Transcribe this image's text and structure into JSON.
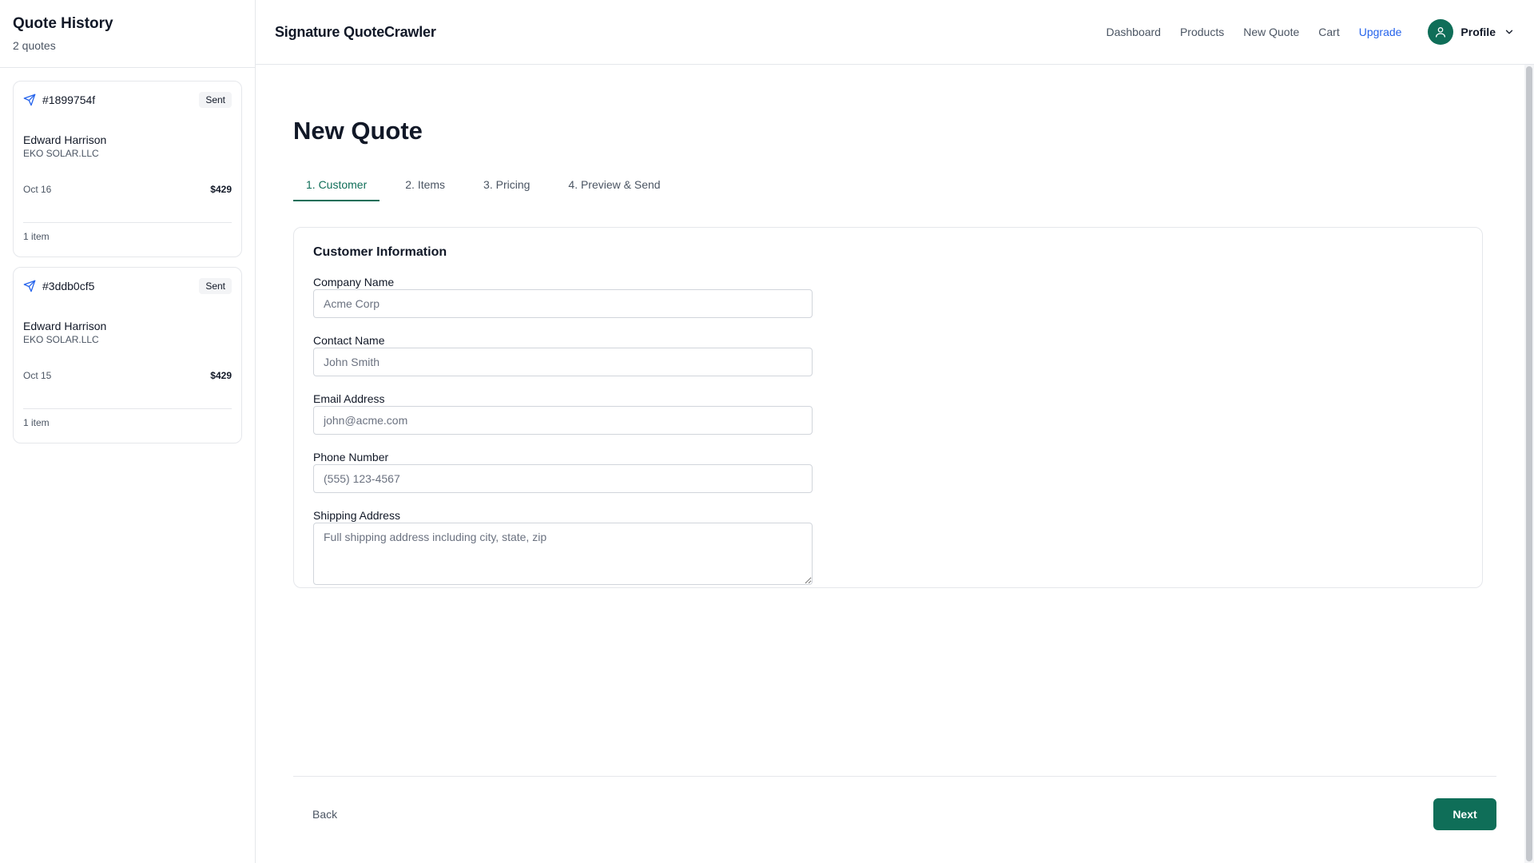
{
  "sidebar": {
    "title": "Quote History",
    "count": "2 quotes",
    "quotes": [
      {
        "id": "#1899754f",
        "status": "Sent",
        "customer": "Edward Harrison",
        "company": "EKO SOLAR.LLC",
        "date": "Oct 16",
        "total": "$429",
        "items": "1 item"
      },
      {
        "id": "#3ddb0cf5",
        "status": "Sent",
        "customer": "Edward Harrison",
        "company": "EKO SOLAR.LLC",
        "date": "Oct 15",
        "total": "$429",
        "items": "1 item"
      }
    ]
  },
  "topbar": {
    "brand": "Signature QuoteCrawler",
    "nav": [
      "Dashboard",
      "Products",
      "New Quote",
      "Cart",
      "Upgrade"
    ],
    "profile_label": "Profile"
  },
  "page": {
    "title": "New Quote",
    "tabs": [
      "1. Customer",
      "2. Items",
      "3. Pricing",
      "4. Preview & Send"
    ],
    "active_tab": "1. Customer"
  },
  "form": {
    "section_title": "Customer Information",
    "fields": [
      {
        "label": "Company Name",
        "value": "",
        "placeholder": "Acme Corp"
      },
      {
        "label": "Contact Name",
        "value": "",
        "placeholder": "John Smith"
      },
      {
        "label": "Email Address",
        "value": "",
        "placeholder": "john@acme.com"
      },
      {
        "label": "Phone Number",
        "value": "",
        "placeholder": "(555) 123-4567"
      },
      {
        "label": "Shipping Address",
        "value": "",
        "placeholder": "Full shipping address including city, state, zip"
      }
    ]
  },
  "footer": {
    "back_label": "Back",
    "next_label": "Next"
  },
  "colors": {
    "accent": "#0f6e58",
    "link_upgrade": "#2563eb",
    "send_icon": "#2563eb"
  },
  "icons": {
    "quote_status": "send-icon",
    "avatar": "user-icon",
    "profile_menu": "chevron-down-icon"
  }
}
